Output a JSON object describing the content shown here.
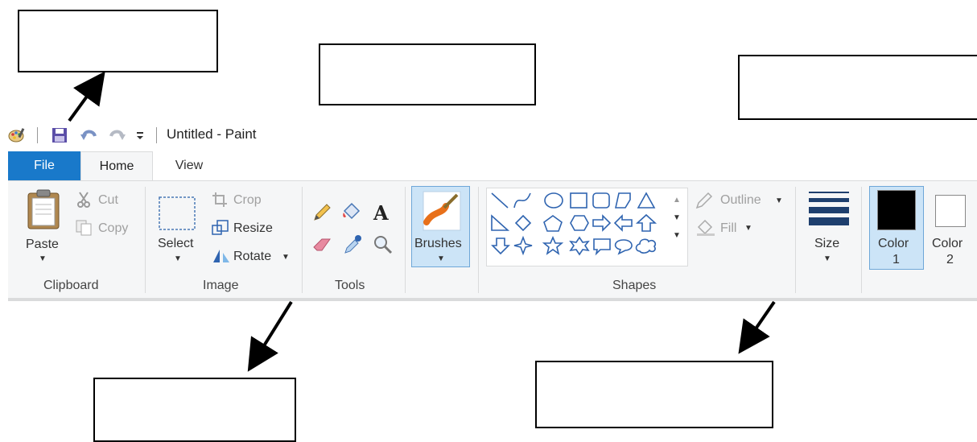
{
  "window": {
    "title": "Untitled - Paint"
  },
  "tabs": [
    {
      "label": "File"
    },
    {
      "label": "Home"
    },
    {
      "label": "View"
    }
  ],
  "clipboard": {
    "paste_label": "Paste",
    "cut_label": "Cut",
    "copy_label": "Copy",
    "group_label": "Clipboard"
  },
  "image": {
    "select_label": "Select",
    "crop_label": "Crop",
    "resize_label": "Resize",
    "rotate_label": "Rotate",
    "group_label": "Image"
  },
  "tools": {
    "group_label": "Tools"
  },
  "brushes": {
    "label": "Brushes"
  },
  "shapes": {
    "outline_label": "Outline",
    "fill_label": "Fill",
    "group_label": "Shapes"
  },
  "size": {
    "label": "Size"
  },
  "colors": {
    "color1_label": "Color",
    "color1_num": "1",
    "color2_label": "Color",
    "color2_num": "2",
    "color1_value": "#000000",
    "color2_value": "#ffffff"
  },
  "accent": {
    "file_tab": "#1979ca",
    "ribbon_bg": "#f5f6f7"
  }
}
